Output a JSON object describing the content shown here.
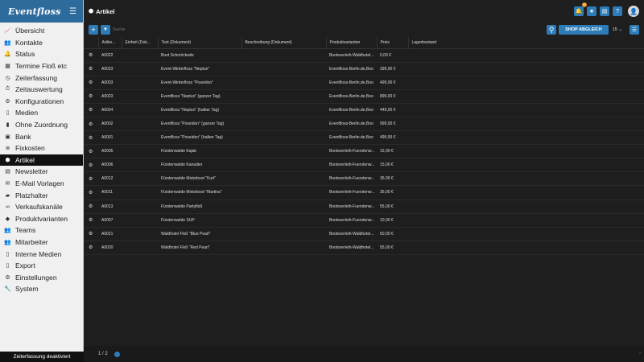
{
  "app": {
    "logo": "Eventfloss",
    "page_title": "Artikel"
  },
  "sidebar": {
    "items": [
      {
        "label": "Übersicht",
        "icon": "chart-icon",
        "glyph": "📈"
      },
      {
        "label": "Kontakte",
        "icon": "users-icon",
        "glyph": "👥"
      },
      {
        "label": "Status",
        "icon": "bell-icon",
        "glyph": "🔔"
      },
      {
        "label": "Termine Floß etc",
        "icon": "calendar-icon",
        "glyph": "▦"
      },
      {
        "label": "Zeiterfassung",
        "icon": "clock-icon",
        "glyph": "◷"
      },
      {
        "label": "Zeitauswertung",
        "icon": "stopwatch-icon",
        "glyph": "⏱"
      },
      {
        "label": "Konfigurationen",
        "icon": "config-icon",
        "glyph": "⚙"
      },
      {
        "label": "Medien",
        "icon": "file-icon",
        "glyph": "▯"
      },
      {
        "label": "Ohne Zuordnung",
        "icon": "files-icon",
        "glyph": "▮"
      },
      {
        "label": "Bank",
        "icon": "bank-icon",
        "glyph": "▣"
      },
      {
        "label": "Fixkosten",
        "icon": "stack-icon",
        "glyph": "≣"
      },
      {
        "label": "Artikel",
        "icon": "box-icon",
        "glyph": "⬢",
        "active": true
      },
      {
        "label": "Newsletter",
        "icon": "newspaper-icon",
        "glyph": "▤"
      },
      {
        "label": "E-Mail Vorlagen",
        "icon": "envelope-icon",
        "glyph": "✉"
      },
      {
        "label": "Platzhalter",
        "icon": "comment-icon",
        "glyph": "▰"
      },
      {
        "label": "Verkaufskanäle",
        "icon": "link-icon",
        "glyph": "∞"
      },
      {
        "label": "Produktvarianten",
        "icon": "tags-icon",
        "glyph": "◆"
      },
      {
        "label": "Teams",
        "icon": "team-icon",
        "glyph": "👥"
      },
      {
        "label": "Mitarbeiter",
        "icon": "employee-icon",
        "glyph": "👥"
      },
      {
        "label": "Interne Medien",
        "icon": "document-icon",
        "glyph": "▯"
      },
      {
        "label": "Export",
        "icon": "export-icon",
        "glyph": "▯"
      },
      {
        "label": "Einstellungen",
        "icon": "settings-icon",
        "glyph": "⚙"
      },
      {
        "label": "System",
        "icon": "wrench-icon",
        "glyph": "🔧"
      }
    ],
    "footer": "Zeiterfassung deaktiviert"
  },
  "topbar": {
    "badge_count": "99",
    "avatar_glyph": "👤"
  },
  "toolbar": {
    "add_glyph": "+",
    "filter_glyph": "▼",
    "search_placeholder": "Suche",
    "search_glyph": "⚲",
    "shop_button": "SHOP ABGLEICH",
    "per_page": "15 ⌄",
    "columns_glyph": "☰"
  },
  "table": {
    "columns": [
      "",
      "Artike...",
      "Einheit (Dok...",
      "Text (Dokument)",
      "Beschreibung (Dokument)",
      "Produktvarianten",
      "Preis",
      "Lagerbestand"
    ],
    "rows": [
      [
        "A0022",
        "",
        "Boot Schmöckwitz",
        "",
        "Bootsverleih-Waldhotel...",
        "0,00 €",
        ""
      ],
      [
        "A0023",
        "",
        "Event-Winterfloss \"Neptun\"",
        "",
        "Eventfloss-Berlin.de,Boo",
        "399,00 €",
        ""
      ],
      [
        "A0003",
        "",
        "Event-Winterfloss \"Poseidon\"",
        "",
        "Eventfloss-Berlin.de,Boo",
        "499,00 €",
        ""
      ],
      [
        "A0023",
        "",
        "Eventfloss \"Neptun\" (ganzer Tag)",
        "",
        "Eventfloss-Berlin.de,Boo",
        "899,00 €",
        ""
      ],
      [
        "A0024",
        "",
        "Eventfloss \"Neptun\" (halber Tag)",
        "",
        "Eventfloss-Berlin.de,Boo",
        "449,00 €",
        ""
      ],
      [
        "A0002",
        "",
        "Eventfloss \"Poseidon\" (ganzer Tag)",
        "",
        "Eventfloss-Berlin.de,Boo",
        "999,00 €",
        ""
      ],
      [
        "A0001",
        "",
        "Eventfloss \"Poseidon\" (halber Tag)",
        "",
        "Eventfloss-Berlin.de,Boo",
        "499,00 €",
        ""
      ],
      [
        "A0005",
        "",
        "Fürstenwalde Kajak",
        "",
        "Bootsverleih-Fuerstenw...",
        "15,00 €",
        ""
      ],
      [
        "A0006",
        "",
        "Fürstenwalde Kanadier",
        "",
        "Bootsverleih-Fuerstenw...",
        "15,00 €",
        ""
      ],
      [
        "A0012",
        "",
        "Fürstenwalde Motorboot \"Kurt\"",
        "",
        "Bootsverleih-Fuerstenw...",
        "35,00 €",
        ""
      ],
      [
        "A0011",
        "",
        "Fürstenwalde Motorboot \"Martina\"",
        "",
        "Bootsverleih-Fuerstenw...",
        "35,00 €",
        ""
      ],
      [
        "A0013",
        "",
        "Fürstenwalde Partyfloß",
        "",
        "Bootsverleih-Fuerstenw...",
        "55,00 €",
        ""
      ],
      [
        "A0007",
        "",
        "Fürstenwalde SUP",
        "",
        "Bootsverleih-Fuerstenw...",
        "10,00 €",
        ""
      ],
      [
        "A0021",
        "",
        "Waldhotel Floß \"Blue Pearl\"",
        "",
        "Bootsverleih-Waldhotel...",
        "60,00 €",
        ""
      ],
      [
        "A0020",
        "",
        "Waldhotel Floß \"Red Pearl\"",
        "",
        "Bootsverleih-Waldhotel...",
        "55,00 €",
        ""
      ]
    ],
    "row_glyph": "⚙"
  },
  "pagination": {
    "page": "1 / 2",
    "next_glyph": "›"
  },
  "colors": {
    "accent": "#2d7cb8",
    "brand": "#2d6b9c",
    "badge": "#e08b1c"
  }
}
